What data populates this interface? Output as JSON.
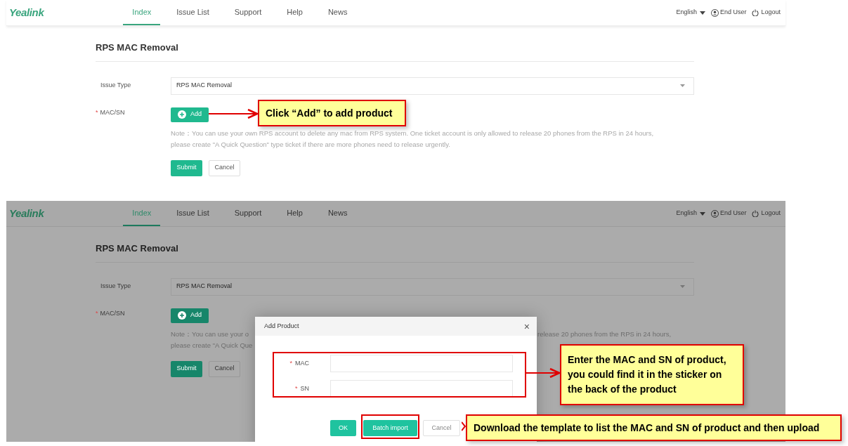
{
  "screens": [
    {
      "dimmed": false,
      "header": {
        "logo": "Yealink",
        "tabs": [
          {
            "label": "Index",
            "selected": true
          },
          {
            "label": "Issue List",
            "selected": false
          },
          {
            "label": "Support",
            "selected": false
          },
          {
            "label": "Help",
            "selected": false
          },
          {
            "label": "News",
            "selected": false
          }
        ],
        "language": "English",
        "user": "End User",
        "logout": "Logout"
      },
      "page_title": "RPS MAC Removal",
      "issue_type": {
        "label": "Issue Type",
        "value": "RPS MAC Removal"
      },
      "mac_sn": {
        "required_mark": "*",
        "label": "MAC/SN",
        "add_button": "Add"
      },
      "note": [
        {
          "left": "Note：You can use your own RPS account to delete any mac from RPS system. One ticket account is only allowed to release 20 phones from the RPS in 24 hours,"
        },
        {
          "left": "please create \"A Quick Question\" type ticket if there are more phones need to release urgently."
        }
      ],
      "buttons": [
        "Submit",
        "Cancel"
      ]
    },
    {
      "dimmed": true,
      "header": {
        "logo": "Yealink",
        "tabs": [
          {
            "label": "Index",
            "selected": true
          },
          {
            "label": "Issue List",
            "selected": false
          },
          {
            "label": "Support",
            "selected": false
          },
          {
            "label": "Help",
            "selected": false
          },
          {
            "label": "News",
            "selected": false
          }
        ],
        "language": "English",
        "user": "End User",
        "logout": "Logout"
      },
      "page_title": "RPS MAC Removal",
      "issue_type": {
        "label": "Issue Type",
        "value": "RPS MAC Removal"
      },
      "mac_sn": {
        "required_mark": "*",
        "label": "MAC/SN",
        "add_button": "Add"
      },
      "note": [
        {
          "left": "Note：You can use your o",
          "right": "release 20 phones from the RPS in 24 hours,"
        },
        {
          "left": "please create \"A Quick Que"
        }
      ],
      "buttons": [
        "Submit",
        "Cancel"
      ],
      "dialog": {
        "title": "Add Product",
        "close": "×",
        "fields": [
          {
            "required_mark": "*",
            "label": "MAC"
          },
          {
            "required_mark": "*",
            "label": "SN"
          }
        ],
        "buttons": [
          "OK",
          "Batch import",
          "Cancel"
        ]
      }
    }
  ],
  "annotations": [
    {
      "text": "Click “Add” to add product"
    },
    {
      "text": "Enter the MAC and SN of product, you could find it in the sticker on the back of the product"
    },
    {
      "text": "Download the template to list the MAC and SN of product and then upload"
    }
  ]
}
